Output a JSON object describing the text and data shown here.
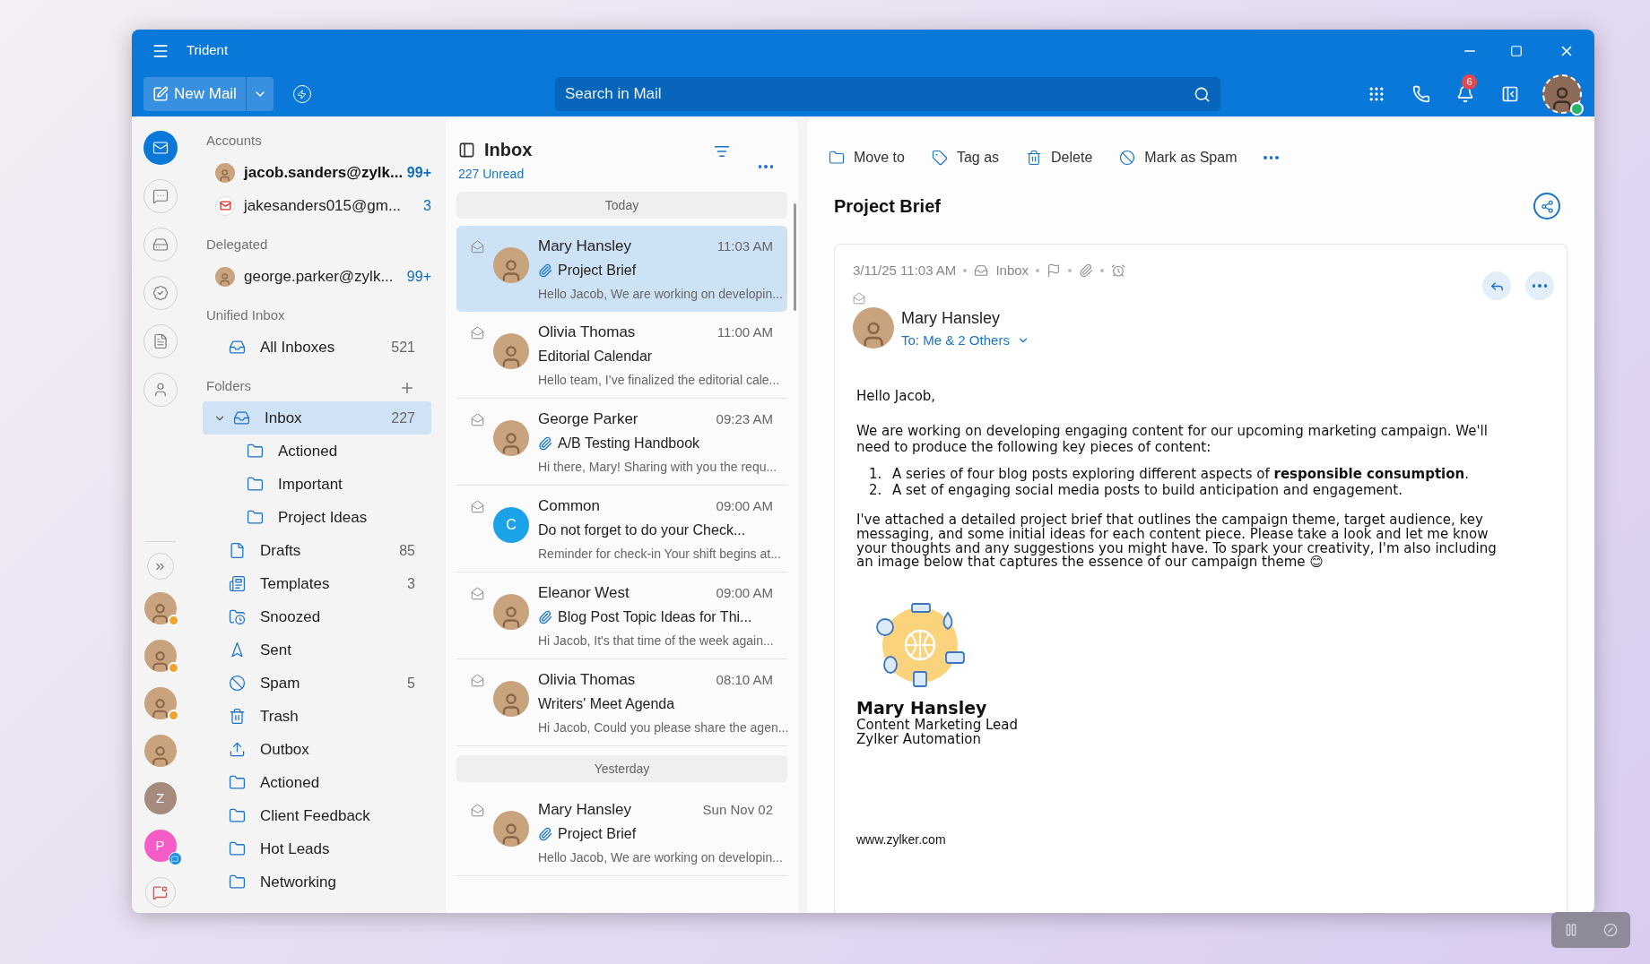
{
  "window": {
    "title": "Trident"
  },
  "toolbar": {
    "new_mail": "New Mail",
    "search": {
      "placeholder": "Search in Mail"
    },
    "notifications": "6",
    "user_online": true
  },
  "rail": {
    "apps": [
      {
        "kind": "mail",
        "selected": true
      },
      {
        "kind": "chat",
        "selected": false
      },
      {
        "kind": "drive",
        "selected": false
      },
      {
        "kind": "tasks",
        "selected": false
      },
      {
        "kind": "notes",
        "selected": false
      },
      {
        "kind": "contacts",
        "selected": false
      }
    ],
    "contacts": [
      {
        "kind": "photo",
        "away": true,
        "chat_badge": false
      },
      {
        "kind": "photo",
        "away": true,
        "chat_badge": false
      },
      {
        "kind": "photo",
        "away": true,
        "chat_badge": false
      },
      {
        "kind": "photo",
        "away": false,
        "chat_badge": false
      },
      {
        "kind": "letter",
        "initial": "Z",
        "color": "#a58a7d",
        "away": false,
        "chat_badge": false
      },
      {
        "kind": "letter",
        "initial": "P",
        "color": "#f45cc6",
        "away": false,
        "chat_badge": true
      }
    ]
  },
  "nav": {
    "accounts_title": "Accounts",
    "accounts": [
      {
        "kind": "avatar",
        "name": "jacob.sanders@zylk...",
        "count": "99+",
        "unread": true
      },
      {
        "kind": "gmail",
        "name": "jakesanders015@gm...",
        "count": "3",
        "unread": false
      }
    ],
    "delegated_title": "Delegated",
    "delegated": [
      {
        "name": "george.parker@zylk...",
        "count": "99+"
      }
    ],
    "unified_title": "Unified Inbox",
    "unified": [
      {
        "name": "All Inboxes",
        "count": "521"
      }
    ],
    "folders_title": "Folders",
    "folders": [
      {
        "kind": "inbox",
        "name": "Inbox",
        "count": "227",
        "selected": true,
        "expanded": true,
        "children": [
          {
            "kind": "folder",
            "name": "Actioned",
            "selected": false
          },
          {
            "kind": "folder",
            "name": "Important",
            "selected": false
          },
          {
            "kind": "folder",
            "name": "Project Ideas",
            "selected": false
          }
        ]
      },
      {
        "kind": "drafts",
        "name": "Drafts",
        "count": "85",
        "selected": false
      },
      {
        "kind": "templates",
        "name": "Templates",
        "count": "3",
        "selected": false
      },
      {
        "kind": "snoozed",
        "name": "Snoozed",
        "selected": false
      },
      {
        "kind": "sent",
        "name": "Sent",
        "selected": false
      },
      {
        "kind": "spam",
        "name": "Spam",
        "count": "5",
        "selected": false
      },
      {
        "kind": "trash",
        "name": "Trash",
        "selected": false
      },
      {
        "kind": "outbox",
        "name": "Outbox",
        "selected": false
      },
      {
        "kind": "folder",
        "name": "Actioned",
        "selected": false
      },
      {
        "kind": "folder",
        "name": "Client Feedback",
        "selected": false
      },
      {
        "kind": "folder",
        "name": "Hot Leads",
        "selected": false
      },
      {
        "kind": "folder",
        "name": "Networking",
        "selected": false
      }
    ]
  },
  "message_list": {
    "title": "Inbox",
    "unread": "227 Unread",
    "groups": [
      {
        "label": "Today",
        "messages": [
          {
            "sender": "Mary Hansley",
            "time": "11:03 AM",
            "subject": "Project Brief",
            "preview": "Hello Jacob, We are working on developin...",
            "attachment": true,
            "selected": true,
            "avatar": {
              "kind": "photo"
            }
          },
          {
            "sender": "Olivia Thomas",
            "time": "11:00 AM",
            "subject": "Editorial Calendar",
            "preview": "Hello team, I’ve finalized the editorial cale...",
            "attachment": false,
            "selected": false,
            "avatar": {
              "kind": "photo"
            }
          },
          {
            "sender": "George Parker",
            "time": "09:23 AM",
            "subject": "A/B Testing Handbook",
            "preview": "Hi there, Mary! Sharing with you the requ...",
            "attachment": true,
            "selected": false,
            "avatar": {
              "kind": "photo"
            }
          },
          {
            "sender": "Common",
            "time": "09:00 AM",
            "subject": "Do not forget to do your Check...",
            "preview": "Reminder for check-in Your shift begins at...",
            "attachment": false,
            "selected": false,
            "avatar": {
              "kind": "letter",
              "initial": "C"
            }
          },
          {
            "sender": "Eleanor West",
            "time": "09:00 AM",
            "subject": "Blog Post Topic Ideas for Thi...",
            "preview": "Hi Jacob, It's that time of the week again...",
            "attachment": true,
            "selected": false,
            "avatar": {
              "kind": "photo"
            }
          },
          {
            "sender": "Olivia Thomas",
            "time": "08:10 AM",
            "subject": "Writers' Meet Agenda",
            "preview": "Hi Jacob, Could you please share the agen...",
            "attachment": false,
            "selected": false,
            "avatar": {
              "kind": "photo"
            }
          }
        ]
      },
      {
        "label": "Yesterday",
        "messages": [
          {
            "sender": "Mary Hansley",
            "time": "Sun Nov 02",
            "subject": "Project Brief",
            "preview": "Hello Jacob, We are working on developin...",
            "attachment": true,
            "selected": false,
            "avatar": {
              "kind": "photo"
            }
          }
        ]
      }
    ]
  },
  "reading": {
    "actions": [
      {
        "kind": "move",
        "label": "Move to"
      },
      {
        "kind": "tag",
        "label": "Tag as"
      },
      {
        "kind": "delete",
        "label": "Delete"
      },
      {
        "kind": "spam",
        "label": "Mark as Spam"
      }
    ],
    "subject": "Project Brief",
    "meta": {
      "date": "3/11/25 11:03 AM",
      "folder": "Inbox"
    },
    "sender": "Mary Hansley",
    "recipients": "To: Me & 2 Others",
    "body": {
      "greeting": "Hello Jacob,",
      "intro": "We are working on developing engaging content for our upcoming marketing campaign. We'll need to produce the following key pieces of content:",
      "list": [
        {
          "number": "1.",
          "text": "A series of four blog posts exploring different aspects of **responsible consumption**."
        },
        {
          "number": "2.",
          "text": "A set of engaging social media posts to build anticipation and engagement."
        }
      ],
      "paragraph": "I've attached a detailed project brief that outlines the campaign theme, target audience, key messaging, and some initial ideas for each content piece. Please take a look and let me know your thoughts and any suggestions you might have. To spark your creativity, I'm also including an image below that captures the essence of our campaign theme 😊"
    },
    "signature": {
      "name": "Mary Hansley",
      "title": "Content Marketing Lead",
      "company": "Zylker Automation"
    },
    "website": "www.zylker.com"
  }
}
